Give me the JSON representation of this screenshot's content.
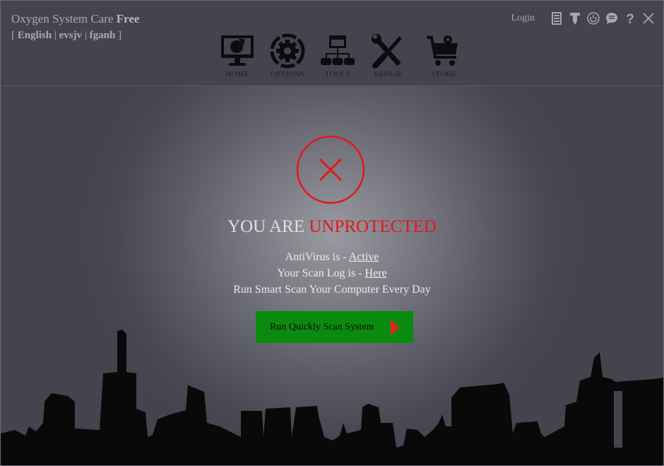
{
  "header": {
    "app_name": "Oxygen System Care",
    "edition": "Free",
    "languages": [
      "English",
      "evsjv",
      "fganh"
    ],
    "lang_open": "[",
    "lang_close": "]",
    "lang_sep": "|",
    "login_label": "Login",
    "icons": [
      "list-icon",
      "pin-icon",
      "power-icon",
      "chat-icon",
      "help-icon",
      "close-icon"
    ]
  },
  "nav": [
    {
      "label": "HOME",
      "icon": "monitor-chart-icon"
    },
    {
      "label": "OPTIONS",
      "icon": "gear-icon"
    },
    {
      "label": "TOOLS",
      "icon": "network-icon"
    },
    {
      "label": "REPAIR",
      "icon": "wrench-screwdriver-icon"
    },
    {
      "label": "STORE",
      "icon": "cart-icon"
    }
  ],
  "status": {
    "headline_prefix": "YOU ARE ",
    "headline_status": "UNPROTECTED",
    "antivirus_prefix": "AntiVirus is - ",
    "antivirus_link": "Active",
    "scanlog_prefix": "Your Scan Log is - ",
    "scanlog_link": "Here",
    "tip": "Run Smart Scan Your Computer Every Day",
    "scan_button": "Run Quickly Scan System"
  },
  "colors": {
    "danger": "#e01a1a",
    "button_green": "#0b8a10",
    "header_bg": "#44444f"
  }
}
